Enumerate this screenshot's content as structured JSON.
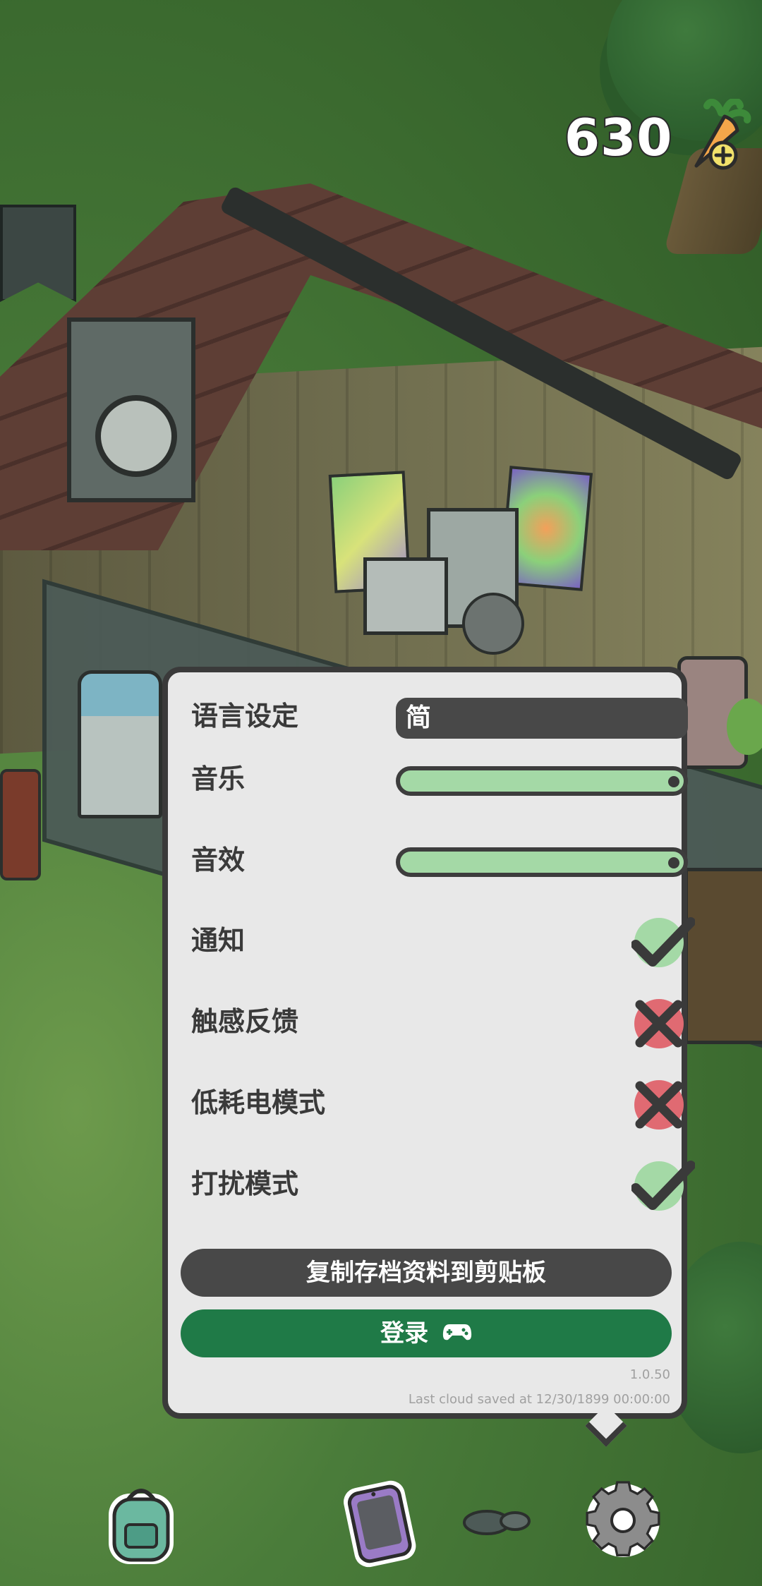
{
  "currency": {
    "value": "630",
    "icon": "carrot-plus-icon"
  },
  "settings": {
    "language": {
      "label": "语言设定",
      "value": "简"
    },
    "music": {
      "label": "音乐",
      "level": 1.0
    },
    "sfx": {
      "label": "音效",
      "level": 1.0
    },
    "notifications": {
      "label": "通知",
      "enabled": true
    },
    "haptics": {
      "label": "触感反馈",
      "enabled": false
    },
    "power_saving": {
      "label": "低耗电模式",
      "enabled": false
    },
    "do_not_disturb": {
      "label": "打扰模式",
      "enabled": true
    }
  },
  "buttons": {
    "copy_save": "复制存档资料到剪贴板",
    "login": "登录"
  },
  "footer": {
    "version": "1.0.50",
    "cloud_saved": "Last cloud saved at 12/30/1899 00:00:00"
  },
  "colors": {
    "toggle_on": "#a4d9a6",
    "toggle_off": "#e06a72",
    "login_button": "#1f7a47",
    "dark_button": "#484848",
    "panel_bg": "#e8e8e8"
  },
  "bottom_bar": [
    "backpack-icon",
    "phone-icon",
    "gear-icon"
  ]
}
